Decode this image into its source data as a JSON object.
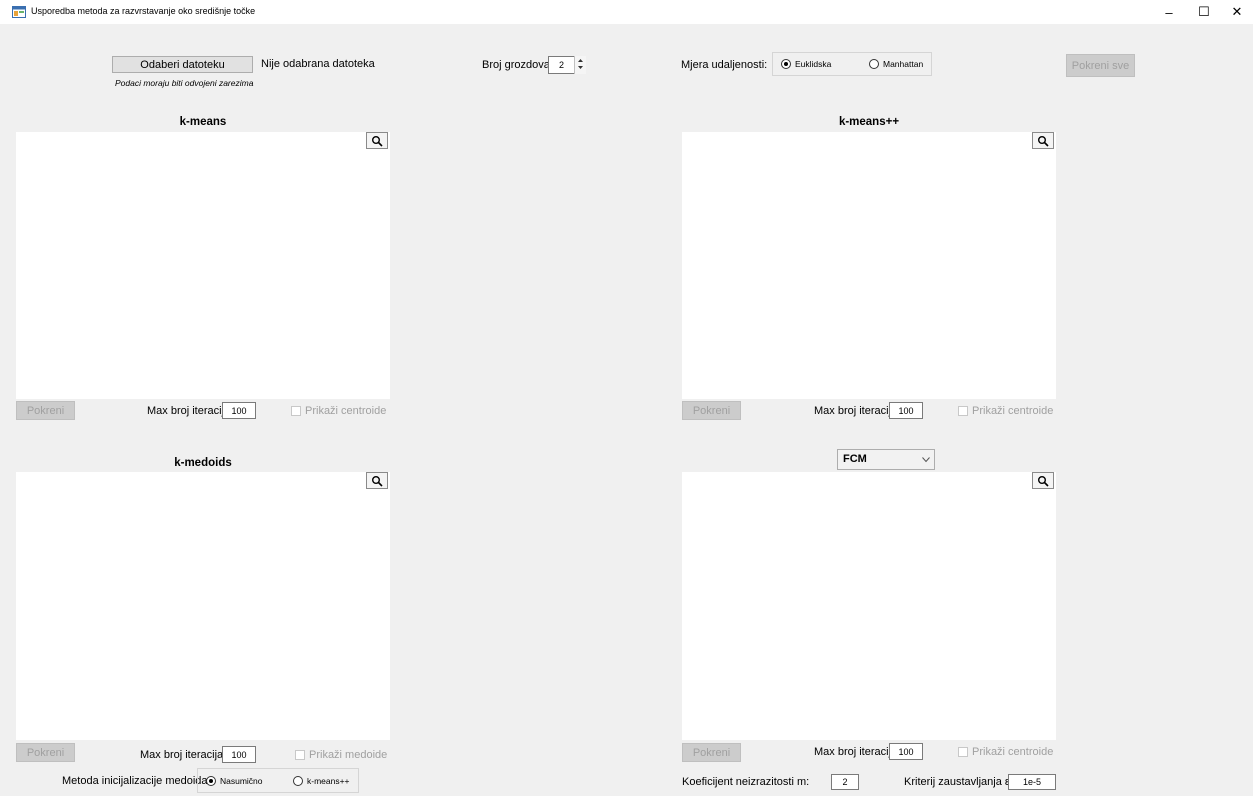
{
  "window": {
    "title": "Usporedba metoda za razvrstavanje oko središnje točke",
    "minimize": "–",
    "maximize": "☐",
    "close": "✕"
  },
  "top": {
    "choose_file_label": "Odaberi datoteku",
    "file_status": "Nije odabrana datoteka",
    "note": "Podaci moraju biti odvojeni zarezima",
    "clusters_label": "Broj grozdova:",
    "clusters_value": "2",
    "distance_label": "Mjera udaljenosti:",
    "distance_options": [
      "Euklidska",
      "Manhattan"
    ],
    "distance_selected": "Euklidska",
    "run_all_label": "Pokreni sve"
  },
  "panels": {
    "kmeans": {
      "title": "k-means",
      "run_label": "Pokreni",
      "iter_label": "Max broj iteracija:",
      "iter_value": "100",
      "show_label": "Prikaži centroide"
    },
    "kmeanspp": {
      "title": "k-means++",
      "run_label": "Pokreni",
      "iter_label": "Max broj iteracija:",
      "iter_value": "100",
      "show_label": "Prikaži centroide"
    },
    "kmedoids": {
      "title": "k-medoids",
      "run_label": "Pokreni",
      "iter_label": "Max broj iteracija:",
      "iter_value": "100",
      "show_label": "Prikaži medoide",
      "init_label": "Metoda inicijalizacije medoida:",
      "init_options": [
        "Nasumično",
        "k-means++"
      ],
      "init_selected": "Nasumično"
    },
    "fcm": {
      "algorithm_selected": "FCM",
      "run_label": "Pokreni",
      "iter_label": "Max broj iteracija:",
      "iter_value": "100",
      "show_label": "Prikaži centroide",
      "fuzz_label": "Koeficijent neizrazitosti m:",
      "fuzz_value": "2",
      "stop_label": "Kriterij zaustavljanja ε:",
      "stop_value": "1e-5"
    }
  },
  "icons": {
    "zoom": "magnifier-icon",
    "app": "app-window-icon",
    "dropdown": "chevron-down-icon",
    "spin": "spin-arrows-icon"
  }
}
